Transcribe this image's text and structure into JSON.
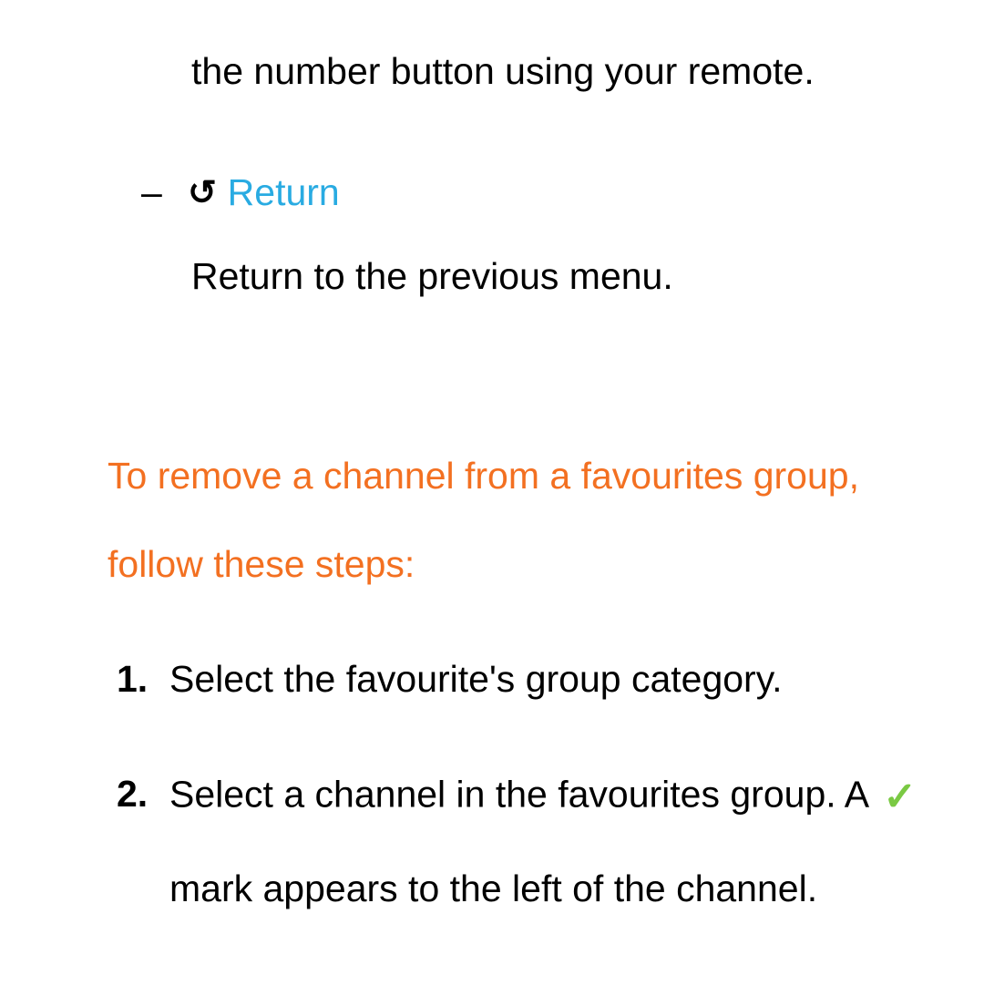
{
  "partial_text": "the number button using your remote.",
  "return_item": {
    "dash": "–",
    "label": "Return",
    "description": "Return to the previous menu."
  },
  "heading": "To remove a channel from a favourites group, follow these steps:",
  "steps": [
    {
      "num": "1.",
      "text": "Select the favourite's group category."
    },
    {
      "num": "2.",
      "text_before": "Select a channel in the favourites group. A ",
      "text_after": " mark appears to the left of the channel."
    }
  ]
}
